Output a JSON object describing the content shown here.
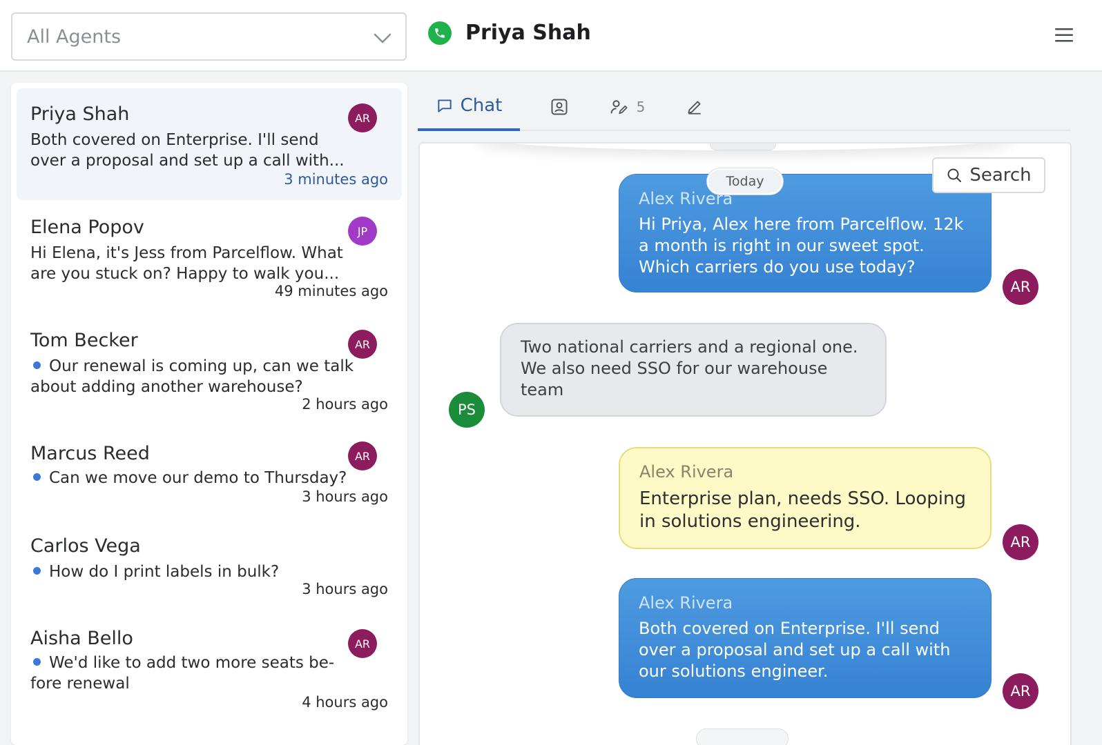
{
  "header": {
    "agent_filter": {
      "value": "All Agents",
      "icon": "chevron-down-icon"
    },
    "contact_name": "Priya Shah",
    "status_icon": "phone-icon",
    "menu_icon": "hamburger-menu-icon",
    "colors": {
      "online": "#20b24a"
    }
  },
  "conversations": [
    {
      "name": "Priya Shah",
      "preview": "Both covered on Enterprise. I'll send over a proposal and set up a call with...",
      "time": "3 minutes ago",
      "agent_initials": "AR",
      "unread": false,
      "selected": true
    },
    {
      "name": "Elena Popov",
      "preview": "Hi Elena, it's Jess from Parcelflow. What are you stuck on? Happy to walk you...",
      "time": "49 minutes ago",
      "agent_initials": "JP",
      "unread": false,
      "selected": false
    },
    {
      "name": "Tom Becker",
      "preview": "Our renewal is coming up, can we talk about adding another warehouse?",
      "time": "2 hours ago",
      "agent_initials": "AR",
      "unread": true,
      "selected": false
    },
    {
      "name": "Marcus Reed",
      "preview": "Can we move our demo to Thursday?",
      "time": "3 hours ago",
      "agent_initials": "AR",
      "unread": true,
      "selected": false
    },
    {
      "name": "Carlos Vega",
      "preview": "How do I print labels in bulk?",
      "time": "3 hours ago",
      "agent_initials": "",
      "unread": true,
      "selected": false
    },
    {
      "name": "Aisha Bello",
      "preview": "We'd like to add two more seats be-fore renewal",
      "time": "4 hours ago",
      "agent_initials": "AR",
      "unread": true,
      "selected": false
    }
  ],
  "tabs": [
    {
      "label": "Chat",
      "icon": "chat-bubble-icon",
      "active": true
    },
    {
      "label": "",
      "icon": "contact-card-icon",
      "active": false
    },
    {
      "label": "",
      "icon": "assign-user-icon",
      "count": "5",
      "active": false
    },
    {
      "label": "",
      "icon": "pencil-icon",
      "active": false
    }
  ],
  "chat": {
    "search_label": "Search",
    "date_divider": "Today",
    "messages": [
      {
        "sender": "Alex Rivera",
        "text": "Hi Priya, Alex here from Parcelflow. 12k a month is right in our sweet spot. Which carriers do you use today?",
        "type": "outgoing",
        "avatar": "AR"
      },
      {
        "sender": "",
        "text": "Two national carriers and a regional one. We also need SSO for our warehouse team",
        "type": "incoming",
        "avatar": "PS"
      },
      {
        "sender": "Alex Rivera",
        "text": "Enterprise plan, needs SSO. Looping in solutions engineering.",
        "type": "note",
        "avatar": "AR"
      },
      {
        "sender": "Alex Rivera",
        "text": "Both covered on Enterprise. I'll send over a proposal and set up a call with our solutions engineer.",
        "type": "outgoing",
        "avatar": "AR"
      }
    ]
  }
}
